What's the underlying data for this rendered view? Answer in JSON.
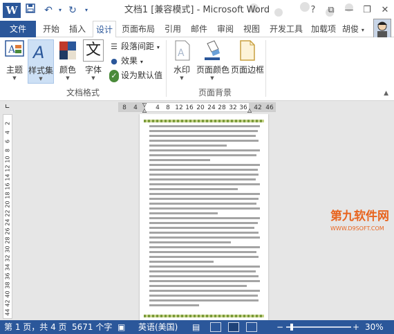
{
  "titlebar": {
    "title": "文档1 [兼容模式] - Microsoft Word",
    "app_icon": "W",
    "save_icon": "save-icon",
    "undo_icon": "undo-icon",
    "redo_icon": "redo-icon",
    "help": "?",
    "ribbon_display": "⧉",
    "minimize": "—",
    "restore": "❐",
    "close": "✕"
  },
  "tabs": {
    "file": "文件",
    "home": "开始",
    "insert": "插入",
    "design": "设计",
    "layout": "页面布局",
    "references": "引用",
    "mailings": "邮件",
    "review": "审阅",
    "view": "视图",
    "developer": "开发工具",
    "addins": "加载项",
    "user": "胡俊"
  },
  "ribbon": {
    "themes": "主题",
    "style_set": "样式集",
    "colors": "颜色",
    "fonts": "字体",
    "paragraph_spacing": "段落间距",
    "effects": "效果",
    "set_default": "设为默认值",
    "group_document_format": "文档格式",
    "watermark": "水印",
    "page_color": "页面颜色",
    "page_borders": "页面边框",
    "group_page_background": "页面背景",
    "font_glyph": "文"
  },
  "ruler": {
    "ticks": [
      "8",
      "4",
      "4",
      "8",
      "12",
      "16",
      "20",
      "24",
      "28",
      "32",
      "36",
      "42",
      "46"
    ],
    "vticks": [
      "2",
      "4",
      "6",
      "8",
      "10",
      "12",
      "14",
      "16",
      "18",
      "20",
      "22",
      "24",
      "26",
      "28",
      "30",
      "32",
      "34",
      "36",
      "38",
      "40",
      "42",
      "44"
    ]
  },
  "watermark_logo": {
    "name": "第九软件网",
    "url": "WWW.D9SOFT.COM"
  },
  "statusbar": {
    "page": "第 1 页，共 4 页",
    "words": "5671 个字",
    "language": "英语(美国)",
    "zoom_minus": "−",
    "zoom_plus": "+",
    "zoom": "30%",
    "zoom_level": 0.3
  },
  "colors": {
    "accent": "#2b579a",
    "page_border": "#7a9a3a"
  }
}
